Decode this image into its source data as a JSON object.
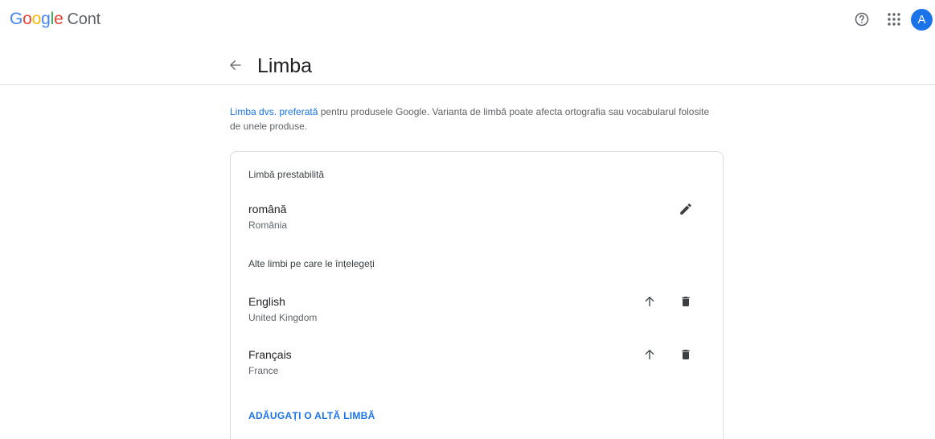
{
  "app": {
    "logo_google": [
      "G",
      "o",
      "o",
      "g",
      "l",
      "e"
    ],
    "logo_product": "Cont",
    "avatar_initial": "A",
    "icons": {
      "help": "help-circle-icon",
      "apps": "apps-grid-icon"
    }
  },
  "page": {
    "title": "Limba",
    "intro_link": "Limba dvs. preferată",
    "intro_text": " pentru produsele Google. Varianta de limbă poate afecta ortografia sau vocabularul folosite de unele produse."
  },
  "default_language": {
    "section_label": "Limbă prestabilită",
    "name": "română",
    "region": "România"
  },
  "other_languages": {
    "section_label": "Alte limbi pe care le înțelegeți",
    "items": [
      {
        "name": "English",
        "region": "United Kingdom"
      },
      {
        "name": "Français",
        "region": "France"
      }
    ]
  },
  "actions": {
    "add_language": "ADĂUGAȚI O ALTĂ LIMBĂ"
  },
  "colors": {
    "accent": "#1a73e8",
    "text": "#202124",
    "secondary": "#5f6368",
    "border": "#dadce0"
  }
}
